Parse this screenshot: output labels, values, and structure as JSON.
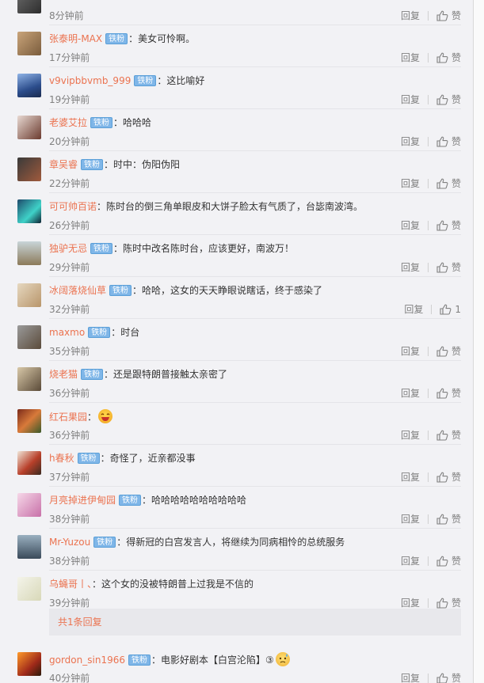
{
  "actions": {
    "reply_label": "回复",
    "like_label": "赞"
  },
  "comments": [
    {
      "name": "",
      "badge": "",
      "sep": "",
      "text": "",
      "time": "8分钟前",
      "likes": ""
    },
    {
      "name": "张泰明-MAX",
      "badge": "铁粉",
      "sep": "：",
      "text": "美女可怜啊。",
      "time": "17分钟前",
      "likes": ""
    },
    {
      "name": "v9vipbbvmb_999",
      "badge": "铁粉",
      "sep": "：",
      "text": "这比喻好",
      "time": "19分钟前",
      "likes": ""
    },
    {
      "name": "老婆艾拉",
      "badge": "铁粉",
      "sep": "：",
      "text": "哈哈哈",
      "time": "20分钟前",
      "likes": ""
    },
    {
      "name": "章吴睿",
      "badge": "铁粉",
      "sep": "：",
      "text": "时中：伪阳伪阳",
      "time": "22分钟前",
      "likes": ""
    },
    {
      "name": "可可帅百诺",
      "badge": "",
      "sep": "：",
      "text": "陈时台的倒三角单眼皮和大饼子脸太有气质了，台毖南波湾。",
      "time": "26分钟前",
      "likes": ""
    },
    {
      "name": "独驴无忌",
      "badge": "铁粉",
      "sep": "：",
      "text": "陈时中改名陈时台，应该更好，南波万！",
      "time": "29分钟前",
      "likes": ""
    },
    {
      "name": "冰阔落烧仙草",
      "badge": "铁粉",
      "sep": "：",
      "text": "哈哈，这女的天天睁眼说瞎话，终于感染了",
      "time": "32分钟前",
      "likes": "1"
    },
    {
      "name": "maxmo",
      "badge": "铁粉",
      "sep": "：",
      "text": "时台",
      "time": "35分钟前",
      "likes": ""
    },
    {
      "name": "烧老猫",
      "badge": "铁粉",
      "sep": "：",
      "text": "还是跟特朗普接触太亲密了",
      "time": "36分钟前",
      "likes": ""
    },
    {
      "name": "红石果园",
      "badge": "",
      "sep": "：",
      "text": "",
      "time": "36分钟前",
      "likes": "",
      "emoji": "laughing-emoji"
    },
    {
      "name": "h春秋",
      "badge": "铁粉",
      "sep": "：",
      "text": "奇怪了，近亲都没事",
      "time": "37分钟前",
      "likes": ""
    },
    {
      "name": "月亮掉进伊甸园",
      "badge": "铁粉",
      "sep": "：",
      "text": "哈哈哈哈哈哈哈哈哈哈",
      "time": "38分钟前",
      "likes": ""
    },
    {
      "name": "Mr-Yuzou",
      "badge": "铁粉",
      "sep": "：",
      "text": "得新冠的白宫发言人，将继续为同病相怜的总统服务",
      "time": "38分钟前",
      "likes": ""
    },
    {
      "name": "乌蝇哥丨、",
      "badge": "",
      "sep": "：",
      "text": "这个女的没被特朗普上过我是不信的",
      "time": "39分钟前",
      "likes": ""
    },
    {
      "name": "gordon_sin1966",
      "badge": "铁粉",
      "sep": "：",
      "text": "电影好剧本【白宫沦陷】③",
      "time": "40分钟前",
      "likes": "",
      "emoji": "sweat-emoji"
    }
  ],
  "more_replies": {
    "label": "共1条回复"
  },
  "colors": {
    "username": "#eb7350",
    "badge_bg": "#7fb6e8",
    "meta": "#808080",
    "page_bg": "#f2f2f5"
  }
}
